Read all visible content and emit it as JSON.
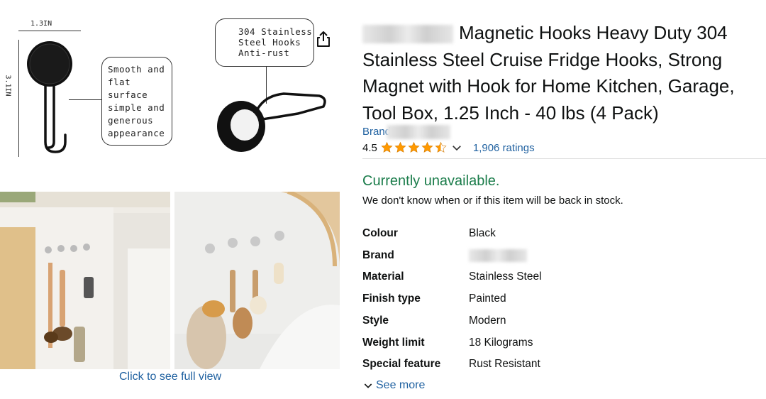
{
  "gallery": {
    "diagram": {
      "width_label": "1.3IN",
      "height_label": "3.1IN",
      "callout_left": [
        "Smooth and",
        "flat surface",
        "simple and",
        "generous",
        "appearance"
      ],
      "callout_right": [
        "304 Stainless",
        "Steel Hooks",
        "Anti-rust"
      ]
    },
    "full_view_link": "Click to see full view"
  },
  "product": {
    "title_line1": "Magnetic Hooks Heavy Duty 304",
    "title_line2": "Stainless Steel Cruise Fridge Hooks, Strong",
    "title_line3": "Magnet with Hook for Home Kitchen, Garage,",
    "title_line4": "Tool Box, 1.25 Inch - 40 lbs (4 Pack)",
    "brand_prefix": "Brand",
    "rating_value": "4.5",
    "rating_stars": 4.5,
    "ratings_count": "1,906 ratings",
    "availability": "Currently unavailable.",
    "availability_note": "We don't know when or if this item will be back in stock.",
    "specs": [
      {
        "label": "Colour",
        "value": "Black"
      },
      {
        "label": "Brand",
        "value": ""
      },
      {
        "label": "Material",
        "value": "Stainless Steel"
      },
      {
        "label": "Finish type",
        "value": "Painted"
      },
      {
        "label": "Style",
        "value": "Modern"
      },
      {
        "label": "Weight limit",
        "value": "18 Kilograms"
      },
      {
        "label": "Special feature",
        "value": "Rust Resistant"
      }
    ],
    "see_more": "See more"
  },
  "colors": {
    "link": "#2162a1",
    "star": "#ff9900",
    "available_green": "#1a7c4a"
  },
  "icons": [
    "share-icon",
    "star-icon",
    "chevron-down-icon"
  ]
}
